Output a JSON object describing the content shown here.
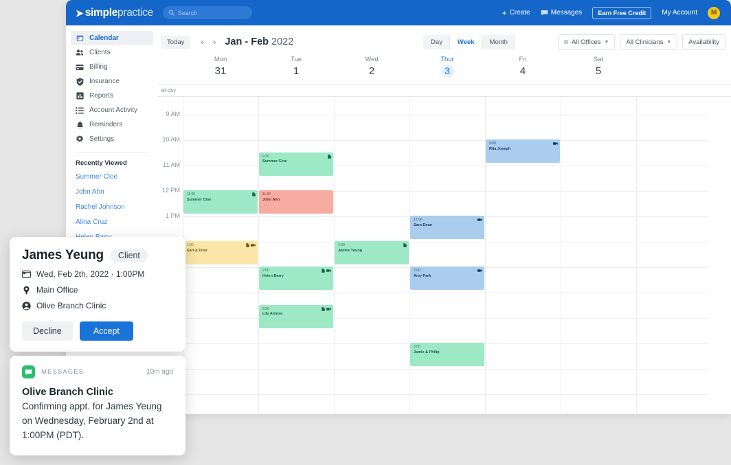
{
  "topnav": {
    "logo_bold": "simple",
    "logo_light": "practice",
    "search_placeholder": "Search",
    "create_label": "Create",
    "messages_label": "Messages",
    "earn_credit_label": "Earn Free Credit",
    "account_label": "My Account",
    "avatar_initial": "M",
    "brand_color": "#1466c8"
  },
  "sidebar": {
    "items": [
      {
        "label": "Calendar",
        "icon": "calendar-icon",
        "active": true
      },
      {
        "label": "Clients",
        "icon": "clients-icon",
        "active": false
      },
      {
        "label": "Billing",
        "icon": "billing-icon",
        "active": false
      },
      {
        "label": "Insurance",
        "icon": "insurance-icon",
        "active": false
      },
      {
        "label": "Reports",
        "icon": "reports-icon",
        "active": false
      },
      {
        "label": "Account Activity",
        "icon": "activity-icon",
        "active": false
      },
      {
        "label": "Reminders",
        "icon": "bell-icon",
        "active": false
      },
      {
        "label": "Settings",
        "icon": "gear-icon",
        "active": false
      }
    ],
    "recent_heading": "Recently Viewed",
    "recent": [
      "Summer Cloe",
      "John Ahn",
      "Rachel Johnson",
      "Alina Cruz",
      "Helen Barry"
    ]
  },
  "toolbar": {
    "today_label": "Today",
    "prev_label": "‹",
    "next_label": "›",
    "title_months": "Jan - Feb",
    "title_year": "2022",
    "views": [
      {
        "label": "Day",
        "active": false
      },
      {
        "label": "Week",
        "active": true
      },
      {
        "label": "Month",
        "active": false
      }
    ],
    "offices_filter": "All Offices",
    "clinicians_filter": "All Clinicians",
    "availability_label": "Availability"
  },
  "calendar": {
    "allday_label": "all-day",
    "days": [
      {
        "weekday": "Mon",
        "number": "31",
        "today": false
      },
      {
        "weekday": "Tue",
        "number": "1",
        "today": false
      },
      {
        "weekday": "Wed",
        "number": "2",
        "today": false
      },
      {
        "weekday": "Thur",
        "number": "3",
        "today": true
      },
      {
        "weekday": "Fri",
        "number": "4",
        "today": false
      },
      {
        "weekday": "Sat",
        "number": "5",
        "today": false
      }
    ],
    "time_labels": [
      "9 AM",
      "10 AM",
      "11 AM",
      "12 PM",
      "1 PM"
    ],
    "events": [
      {
        "time": "9:30",
        "name": "Summer Cloe",
        "col": 1,
        "start": 0.5,
        "dur": 1.0,
        "color": "#9de8c5",
        "text": "#176245",
        "icons": [
          "doc"
        ]
      },
      {
        "time": "11:00",
        "name": "Summer Cloe",
        "col": 0,
        "start": 2.0,
        "dur": 1.0,
        "color": "#9de8c5",
        "text": "#176245",
        "icons": [
          "doc"
        ]
      },
      {
        "time": "11:00",
        "name": "John Ahn",
        "col": 1,
        "start": 2.0,
        "dur": 1.0,
        "color": "#f6aca1",
        "text": "#7a2d22",
        "icons": []
      },
      {
        "time": "9:00",
        "name": "Rita Joseph",
        "col": 4,
        "start": 0.0,
        "dur": 1.0,
        "color": "#aacdee",
        "text": "#16375c",
        "icons": [
          "vid"
        ]
      },
      {
        "time": "12:00",
        "name": "Sara Dean",
        "col": 3,
        "start": 3.0,
        "dur": 1.0,
        "color": "#aacdee",
        "text": "#16375c",
        "icons": [
          "vid"
        ]
      },
      {
        "time": "1:00",
        "name": "Earl & Fran",
        "col": 0,
        "start": 4.0,
        "dur": 1.0,
        "color": "#fae6a6",
        "text": "#6d541a",
        "icons": [
          "doc",
          "vid"
        ]
      },
      {
        "time": "1:00",
        "name": "James Yeung",
        "col": 2,
        "start": 4.0,
        "dur": 1.0,
        "color": "#9de8c5",
        "text": "#176245",
        "icons": [
          "doc"
        ]
      },
      {
        "time": "2:00",
        "name": "Helen Barry",
        "col": 1,
        "start": 5.0,
        "dur": 1.0,
        "color": "#9de8c5",
        "text": "#176245",
        "icons": [
          "doc",
          "vid"
        ]
      },
      {
        "time": "2:00",
        "name": "Amy Park",
        "col": 3,
        "start": 5.0,
        "dur": 1.0,
        "color": "#aacdee",
        "text": "#16375c",
        "icons": [
          "vid"
        ]
      },
      {
        "time": "3:30",
        "name": "Lily Alonso",
        "col": 1,
        "start": 6.5,
        "dur": 1.0,
        "color": "#9de8c5",
        "text": "#176245",
        "icons": [
          "doc",
          "vid"
        ]
      },
      {
        "time": "5:00",
        "name": "Jamie & Philip",
        "col": 3,
        "start": 8.0,
        "dur": 1.0,
        "color": "#9de8c5",
        "text": "#176245",
        "icons": []
      }
    ]
  },
  "appointment_card": {
    "client_name": "James Yeung",
    "badge": "Client",
    "datetime": "Wed, Feb 2th, 2022 · 1:00PM",
    "location": "Main Office",
    "clinic": "Olive Branch Clinic",
    "decline_label": "Decline",
    "accept_label": "Accept"
  },
  "message_card": {
    "source": "MESSAGES",
    "timestamp": "10m ago",
    "title": "Olive Branch Clinic",
    "body": "Confirming appt. for James Yeung on Wednesday, February 2nd at 1:00PM (PDT)."
  }
}
